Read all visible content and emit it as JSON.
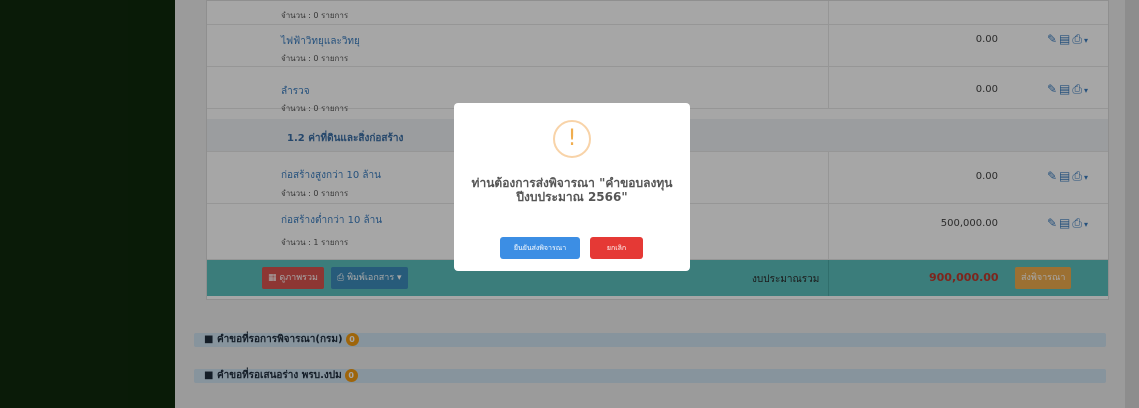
{
  "rows": [
    {
      "count": "จำนวน : 0 รายการ"
    },
    {
      "name": "ไฟฟ้าวิทยุและวิทยุ",
      "count": "จำนวน : 0 รายการ",
      "amount": "0.00"
    },
    {
      "name": "ลำรวจ",
      "count": "จำนวน : 0 รายการ",
      "amount": "0.00"
    },
    {
      "group": "1.2 ค่าที่ดินและสิ่งก่อสร้าง"
    },
    {
      "name": "ก่อสร้างสูงกว่า 10 ล้าน",
      "count": "จำนวน : 0 รายการ",
      "amount": "0.00"
    },
    {
      "name": "ก่อสร้างต่ำกว่า 10 ล้าน",
      "count": "จำนวน : 1 รายการ",
      "amount": "500,000.00"
    }
  ],
  "footer": {
    "summary_button": "ดูภาพรวม",
    "print_button": "พิมพ์เอกสาร",
    "total_label": "งบประมาณรวม",
    "total_value": "900,000.00",
    "submit_button": "ส่งพิจารณา"
  },
  "panels": [
    {
      "title": "คำขอที่รอการพิจารณา(กรม)",
      "badge": "0"
    },
    {
      "title": "คำขอที่รอเสนอร่าง พรบ.งปม",
      "badge": "0"
    }
  ],
  "modal": {
    "icon": "!",
    "message": "ท่านต้องการส่งพิจารณา \"คำขอบลงทุน ปีงบประมาณ 2566\"",
    "confirm_label": "ยืนยันส่งพิจารณา",
    "cancel_label": "ยกเลิก"
  },
  "colors": {
    "sidebar": "#0f2a0c",
    "footer": "#5bc0be",
    "confirm": "#3c8ee4",
    "cancel": "#e53935",
    "badge": "#f39c12"
  }
}
